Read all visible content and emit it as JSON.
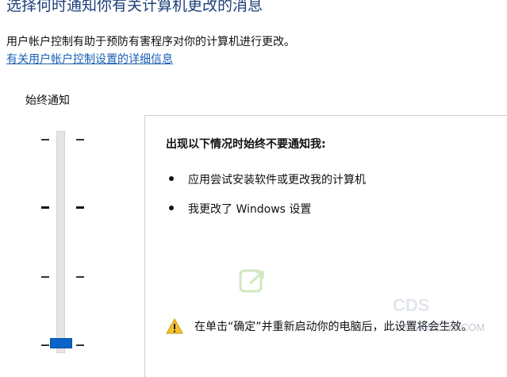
{
  "header": {
    "title": "选择何时通知你有关计算机更改的消息",
    "description": "用户帐户控制有助于预防有害程序对你的计算机进行更改。",
    "link_label": "有关用户帐户控制设置的详细信息"
  },
  "slider": {
    "top_label": "始终通知",
    "selected_level_index": 3,
    "levels": 4
  },
  "panel": {
    "heading": "出现以下情况时始终不要通知我:",
    "bullets": [
      "应用尝试安装软件或更改我的计算机",
      "我更改了 Windows 设置"
    ],
    "note": "在单击“确定”并重新启动你的电脑后，此设置将会生效。"
  },
  "watermark": {
    "domain_text": "WWW.CDS.COM",
    "brand_text": "CDS"
  },
  "colors": {
    "title": "#1e3f7a",
    "link": "#1a5fb4",
    "slider_thumb": "#0a63c8",
    "warning": "#f2c12e"
  }
}
